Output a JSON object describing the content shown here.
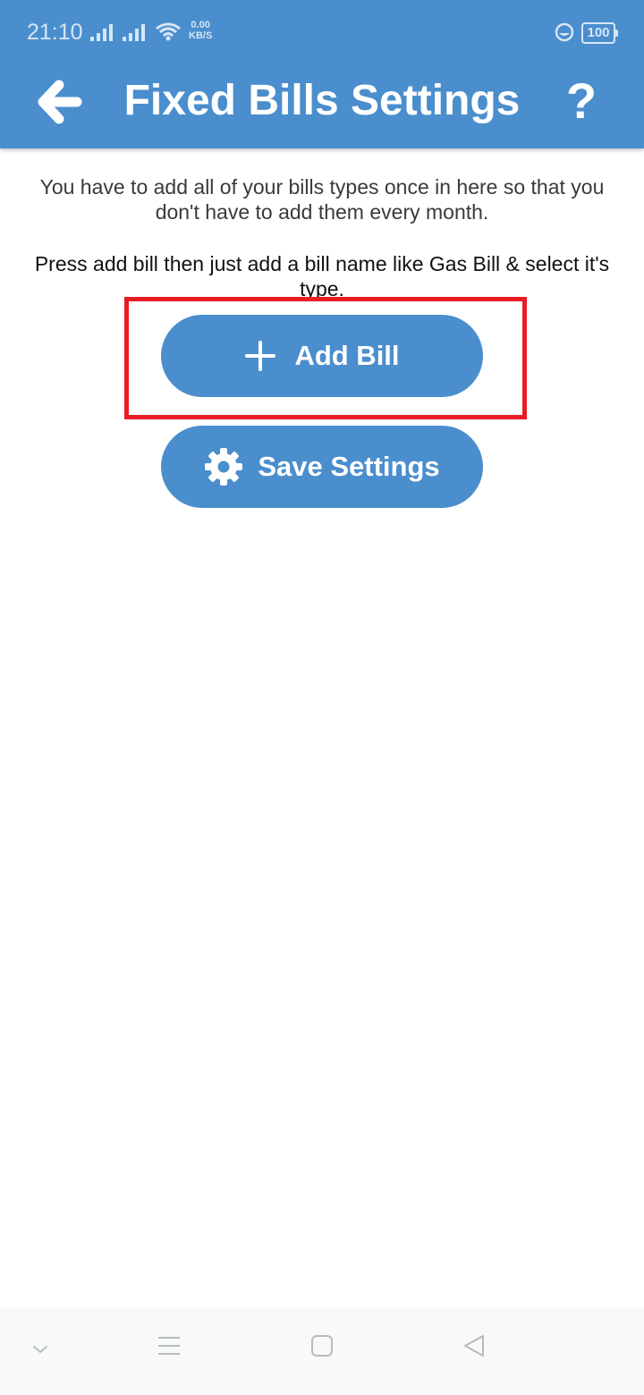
{
  "colors": {
    "primary": "#4a8ecd",
    "highlight": "#e81c24"
  },
  "status_bar": {
    "time": "21:10",
    "net_speed_value": "0.00",
    "net_speed_unit": "KB/S",
    "battery": "100",
    "icons": [
      "signal-icon",
      "signal-icon",
      "wifi-icon",
      "eye-comfort-icon",
      "battery-icon"
    ]
  },
  "header": {
    "title": "Fixed Bills Settings",
    "help_label": "?",
    "back_icon": "back-arrow-icon"
  },
  "main": {
    "intro_text": "You have to add all of your bills types once in here so that you don't have to add them every month.",
    "instruction_text": "Press add bill then just add a bill name like Gas Bill & select it's type.",
    "add_bill_label": "Add Bill",
    "add_bill_icon": "plus-icon",
    "save_settings_label": "Save Settings",
    "save_settings_icon": "gear-icon"
  },
  "nav_bar": {
    "icons": [
      "collapse-icon",
      "menu-icon",
      "home-icon",
      "back-icon"
    ]
  }
}
